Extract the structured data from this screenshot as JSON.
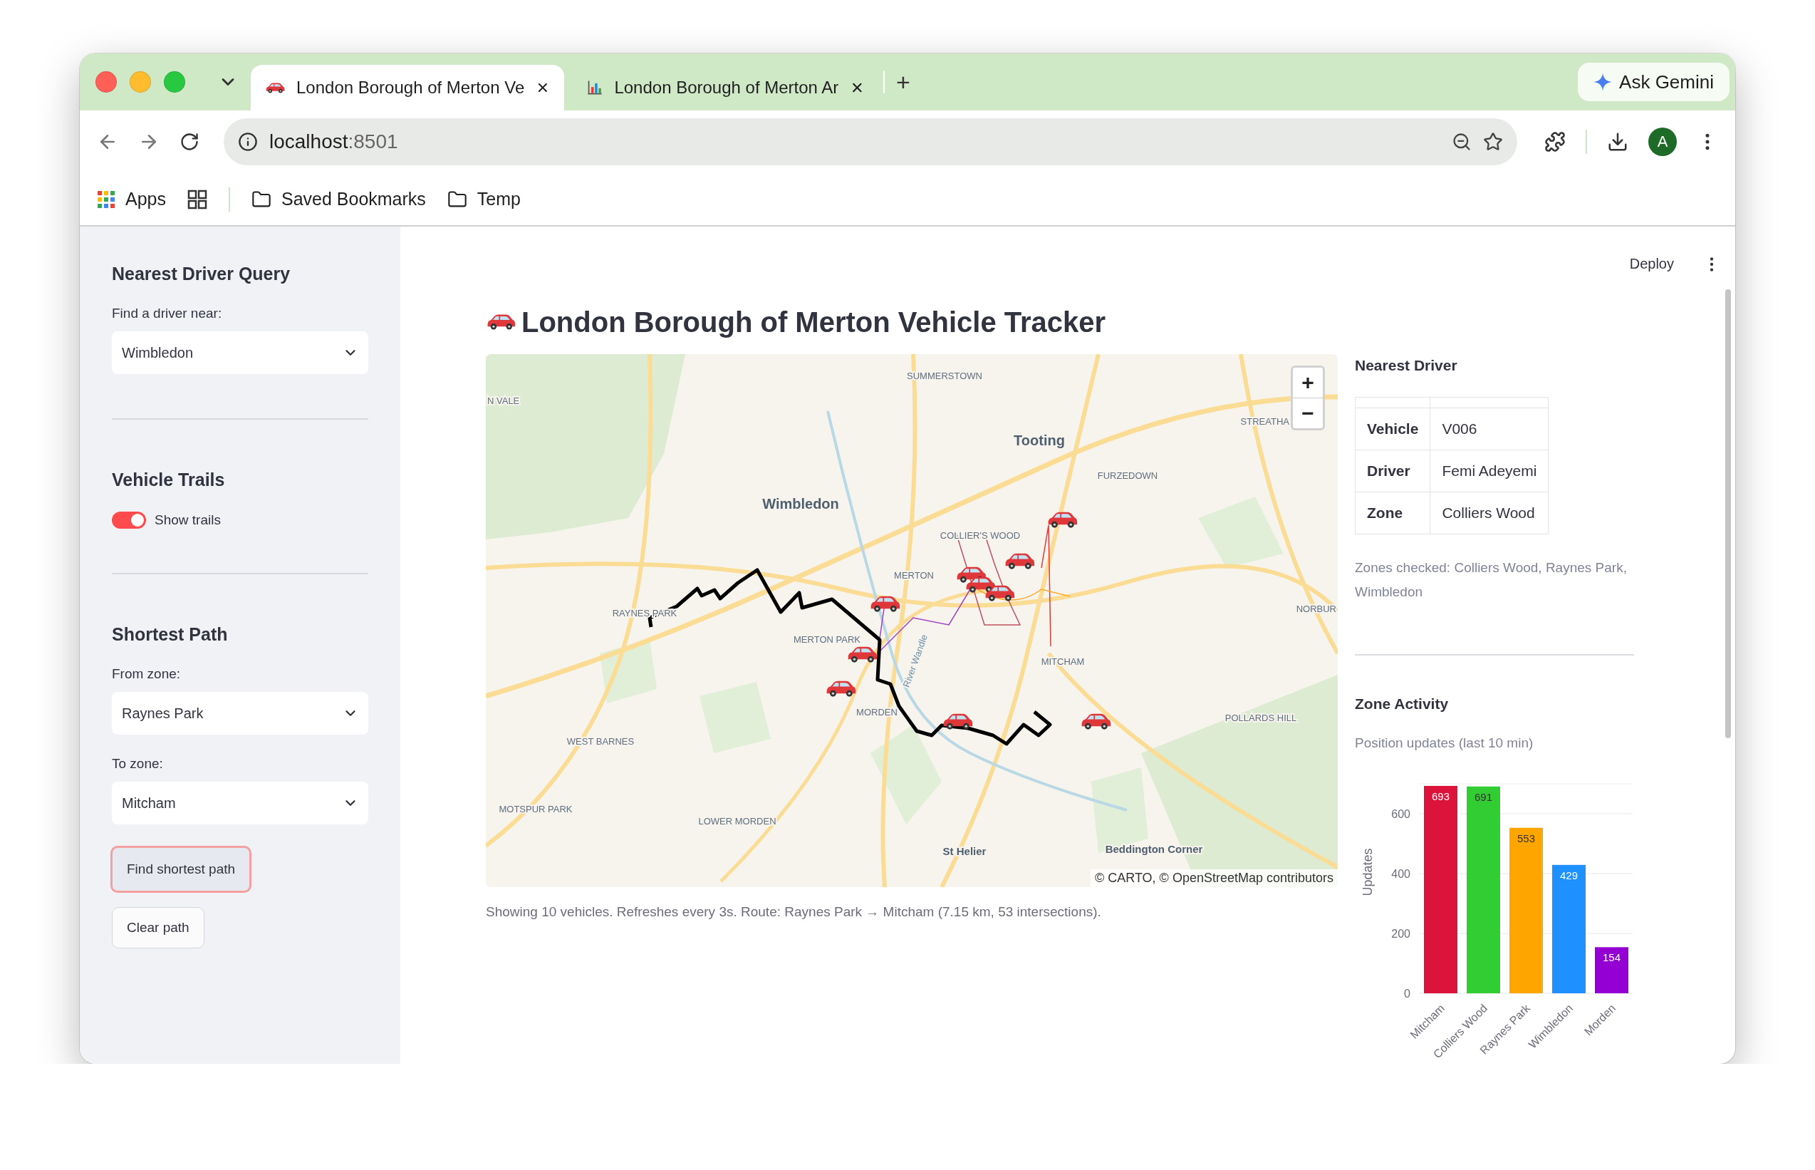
{
  "browser": {
    "tabs": [
      {
        "title": "London Borough of Merton Ve",
        "kind": "car",
        "selected": true
      },
      {
        "title": "London Borough of Merton Ar",
        "kind": "chart",
        "selected": false
      }
    ],
    "new_tab": "+",
    "ask_button": "Ask Gemini",
    "address": {
      "host": "localhost",
      "port": ":8501"
    },
    "avatar": "A",
    "bookmarks": [
      {
        "label": "Apps",
        "kind": "apps"
      },
      {
        "label": "Saved Bookmarks",
        "kind": "folder"
      },
      {
        "label": "Temp",
        "kind": "folder"
      }
    ]
  },
  "sidebar": {
    "sections": [
      {
        "heading": "Nearest Driver Query",
        "controls": [
          {
            "kind": "select",
            "label": "Find a driver near:",
            "value": "Wimbledon"
          }
        ]
      },
      {
        "heading": "Vehicle Trails",
        "controls": [
          {
            "kind": "toggle",
            "label": "Show trails",
            "on": true
          }
        ]
      },
      {
        "heading": "Shortest Path",
        "controls": [
          {
            "kind": "select",
            "label": "From zone:",
            "value": "Raynes Park"
          },
          {
            "kind": "select",
            "label": "To zone:",
            "value": "Mitcham"
          },
          {
            "kind": "button",
            "label": "Find shortest path",
            "focused": true
          },
          {
            "kind": "button",
            "label": "Clear path",
            "focused": false
          }
        ]
      }
    ]
  },
  "header": {
    "deploy": "Deploy"
  },
  "title": "London Borough of Merton Vehicle Tracker",
  "map": {
    "labels": [
      {
        "text": "SUMMERSTOWN",
        "kind": "district"
      },
      {
        "text": "N VALE",
        "kind": "district"
      },
      {
        "text": "STREATHA",
        "kind": "district"
      },
      {
        "text": "Tooting",
        "kind": "town"
      },
      {
        "text": "FURZEDOWN",
        "kind": "district"
      },
      {
        "text": "Wimbledon",
        "kind": "town"
      },
      {
        "text": "COLLIER'S WOOD",
        "kind": "district"
      },
      {
        "text": "MERTON",
        "kind": "district"
      },
      {
        "text": "RAYNES PARK",
        "kind": "district"
      },
      {
        "text": "NORBUR",
        "kind": "district"
      },
      {
        "text": "MERTON PARK",
        "kind": "district"
      },
      {
        "text": "MITCHAM",
        "kind": "district"
      },
      {
        "text": "MORDEN",
        "kind": "district"
      },
      {
        "text": "POLLARDS HILL",
        "kind": "district"
      },
      {
        "text": "WEST BARNES",
        "kind": "district"
      },
      {
        "text": "MOTSPUR PARK",
        "kind": "district"
      },
      {
        "text": "LOWER MORDEN",
        "kind": "district"
      },
      {
        "text": "St Helier",
        "kind": "place"
      },
      {
        "text": "Beddington Corner",
        "kind": "place"
      },
      {
        "text": "River Wandle",
        "kind": "river"
      }
    ],
    "zoom_in": "+",
    "zoom_out": "−",
    "attribution": "© CARTO, © OpenStreetMap contributors"
  },
  "caption": "Showing 10 vehicles. Refreshes every 3s. Route: Raynes Park → Mitcham (7.15 km, 53 intersections).",
  "nearest_driver": {
    "heading": "Nearest Driver",
    "rows": [
      {
        "field": "Vehicle",
        "value": "V006"
      },
      {
        "field": "Driver",
        "value": "Femi Adeyemi"
      },
      {
        "field": "Zone",
        "value": "Colliers Wood"
      }
    ],
    "note": "Zones checked: Colliers Wood, Raynes Park, Wimbledon"
  },
  "zone_activity": {
    "heading": "Zone Activity",
    "subtitle": "Position updates (last 10 min)",
    "chart_data": {
      "type": "bar",
      "ylabel": "Updates",
      "categories": [
        "Mitcham",
        "Colliers Wood",
        "Raynes Park",
        "Wimbledon",
        "Morden"
      ],
      "values": [
        693,
        691,
        553,
        429,
        154
      ],
      "colors": [
        "#dc143c",
        "#32cd32",
        "#ffa500",
        "#1e90ff",
        "#9400d3"
      ],
      "yticks": [
        0,
        200,
        400,
        600
      ],
      "ylim": [
        0,
        700
      ],
      "grid": true,
      "data_labels": true
    }
  }
}
